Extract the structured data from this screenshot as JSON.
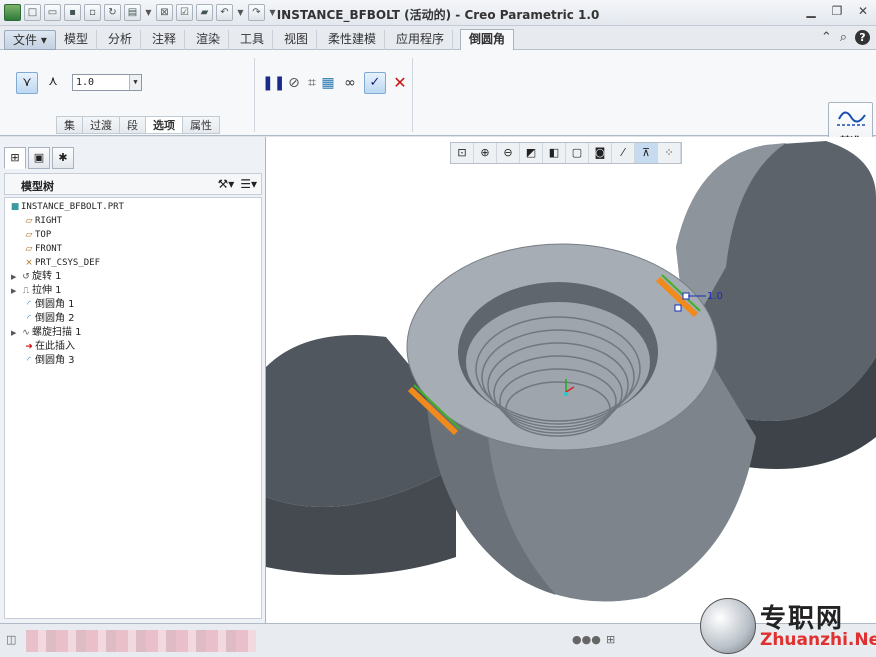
{
  "window": {
    "title": "INSTANCE_BFBOLT (活动的) - Creo Parametric 1.0"
  },
  "tabs": [
    {
      "label": "文件",
      "kind": "file"
    },
    {
      "label": "模型"
    },
    {
      "label": "分析"
    },
    {
      "label": "注释"
    },
    {
      "label": "渲染"
    },
    {
      "label": "工具"
    },
    {
      "label": "视图"
    },
    {
      "label": "柔性建模"
    },
    {
      "label": "应用程序"
    },
    {
      "label": "倒圆角",
      "active": true
    }
  ],
  "ribbon": {
    "radius_value": "1.0",
    "subtabs": [
      "集",
      "过渡",
      "段",
      "选项",
      "属性"
    ],
    "active_subtab": "选项",
    "datum_label": "基准"
  },
  "model_tree": {
    "header": "模型树",
    "items": [
      {
        "label": "INSTANCE_BFBOLT.PRT",
        "icon": "part-icon",
        "level": 0,
        "mono": true
      },
      {
        "label": "RIGHT",
        "icon": "datum-plane-icon",
        "level": 1,
        "mono": true
      },
      {
        "label": "TOP",
        "icon": "datum-plane-icon",
        "level": 1,
        "mono": true
      },
      {
        "label": "FRONT",
        "icon": "datum-plane-icon",
        "level": 1,
        "mono": true
      },
      {
        "label": "PRT_CSYS_DEF",
        "icon": "csys-icon",
        "level": 1,
        "mono": true
      },
      {
        "label": "旋转 1",
        "icon": "revolve-icon",
        "level": 1,
        "expand": true
      },
      {
        "label": "拉伸 1",
        "icon": "extrude-icon",
        "level": 1,
        "expand": true
      },
      {
        "label": "倒圆角 1",
        "icon": "round-icon",
        "level": 1
      },
      {
        "label": "倒圆角 2",
        "icon": "round-icon",
        "level": 1
      },
      {
        "label": "螺旋扫描 1",
        "icon": "helical-sweep-icon",
        "level": 1,
        "expand": true
      },
      {
        "label": "在此插入",
        "icon": "insert-here-icon",
        "level": 1
      },
      {
        "label": "倒圆角 3",
        "icon": "round-icon",
        "level": 1
      }
    ]
  },
  "viewport": {
    "dimension_label": "1.0"
  },
  "watermark": {
    "chinese": "专职网",
    "english": "Zhuanzhi.Net"
  },
  "colors": {
    "model_gray": "#9aa1a8",
    "model_dark": "#4a5057",
    "highlight_orange": "#f08a1c",
    "highlight_green": "#43b02a",
    "dimension_blue": "#1b2fb8"
  }
}
